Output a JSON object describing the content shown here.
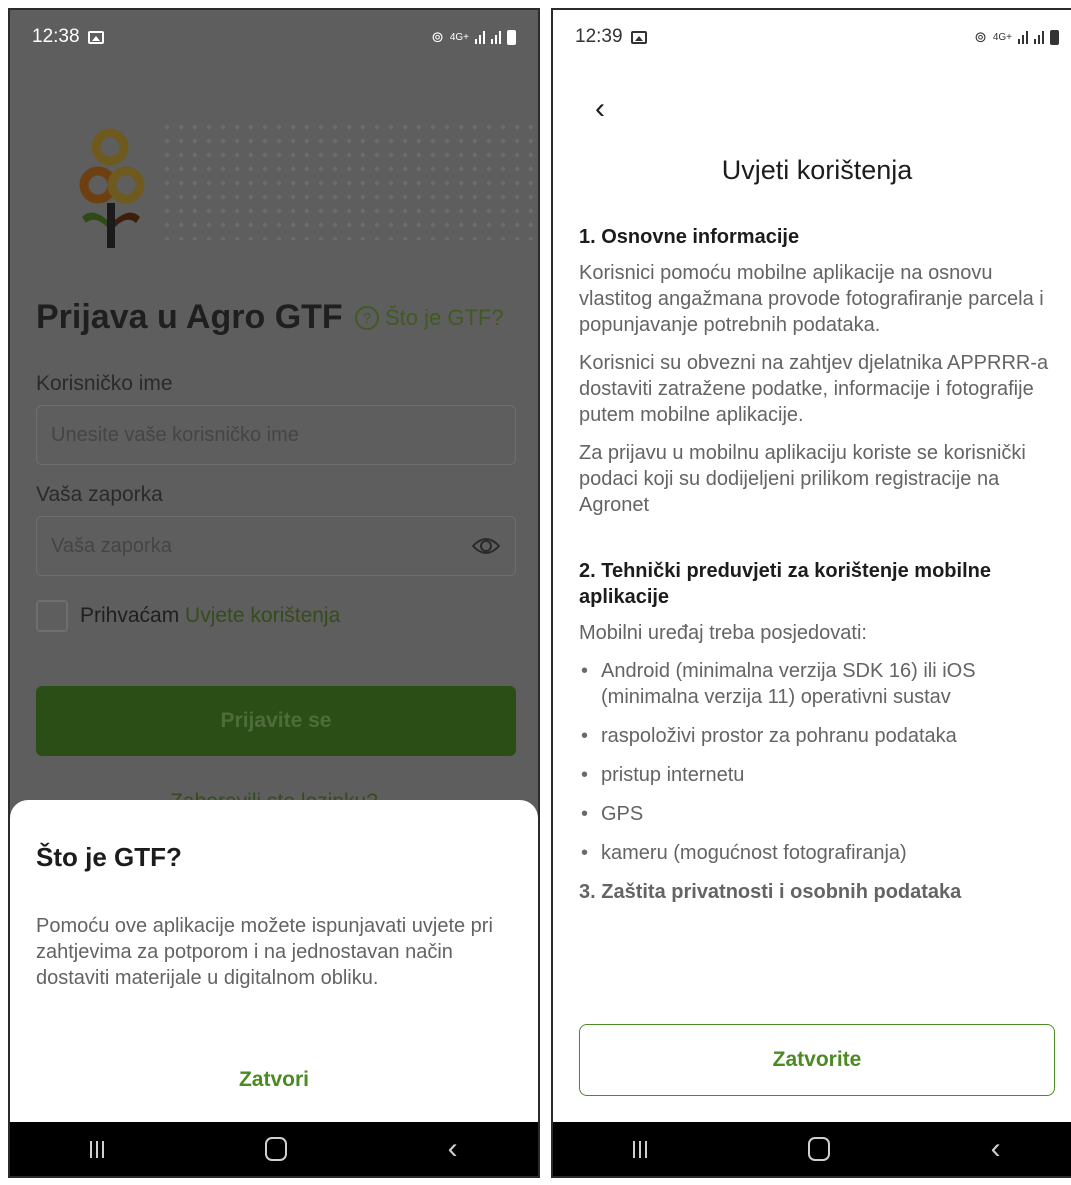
{
  "left_screen": {
    "status": {
      "time": "12:38",
      "network": "4G+"
    },
    "title": "Prijava u Agro GTF",
    "help_link": "Što je GTF?",
    "username": {
      "label": "Korisničko ime",
      "placeholder": "Unesite vaše korisničko ime"
    },
    "password": {
      "label": "Vaša zaporka",
      "placeholder": "Vaša zaporka"
    },
    "accept": {
      "text": "Prihvaćam",
      "link": "Uvjete korištenja",
      "checked": false
    },
    "login_button": "Prijavite se",
    "forgot_link": "Zaboravili ste lozinku?",
    "sheet": {
      "title": "Što je GTF?",
      "body": "Pomoću ove aplikacije možete ispunjavati uvjete pri zahtjevima za potporom i na jednostavan način dostaviti materijale u digitalnom obliku.",
      "close": "Zatvori"
    },
    "colors": {
      "overlay": "#5e5e5e",
      "accent": "#4c8a22"
    }
  },
  "right_screen": {
    "status": {
      "time": "12:39",
      "network": "4G+"
    },
    "title": "Uvjeti korištenja",
    "section1": {
      "title": "1. Osnovne informacije",
      "paragraphs": [
        "Korisnici pomoću mobilne aplikacije na osnovu vlastitog angažmana provode fotografiranje parcela i popunjavanje potrebnih podataka.",
        "Korisnici su obvezni na zahtjev djelatnika APPRRR-a dostaviti zatražene podatke, informacije i fotografije putem mobilne aplikacije.",
        "Za prijavu u mobilnu aplikaciju koriste se korisnički podaci koji su dodijeljeni prilikom registracije na Agronet"
      ]
    },
    "section2": {
      "title": "2. Tehnički preduvjeti za korištenje mobilne aplikacije",
      "intro": "Mobilni uređaj treba posjedovati:",
      "items": [
        "Android (minimalna verzija SDK 16) ili iOS (minimalna verzija 11) operativni sustav",
        "raspoloživi prostor za pohranu podataka",
        "pristup internetu",
        "GPS",
        "kameru (mogućnost fotografiranja)"
      ]
    },
    "section3_title": "3. Zaštita privatnosti i osobnih podataka",
    "close_button": "Zatvorite"
  }
}
